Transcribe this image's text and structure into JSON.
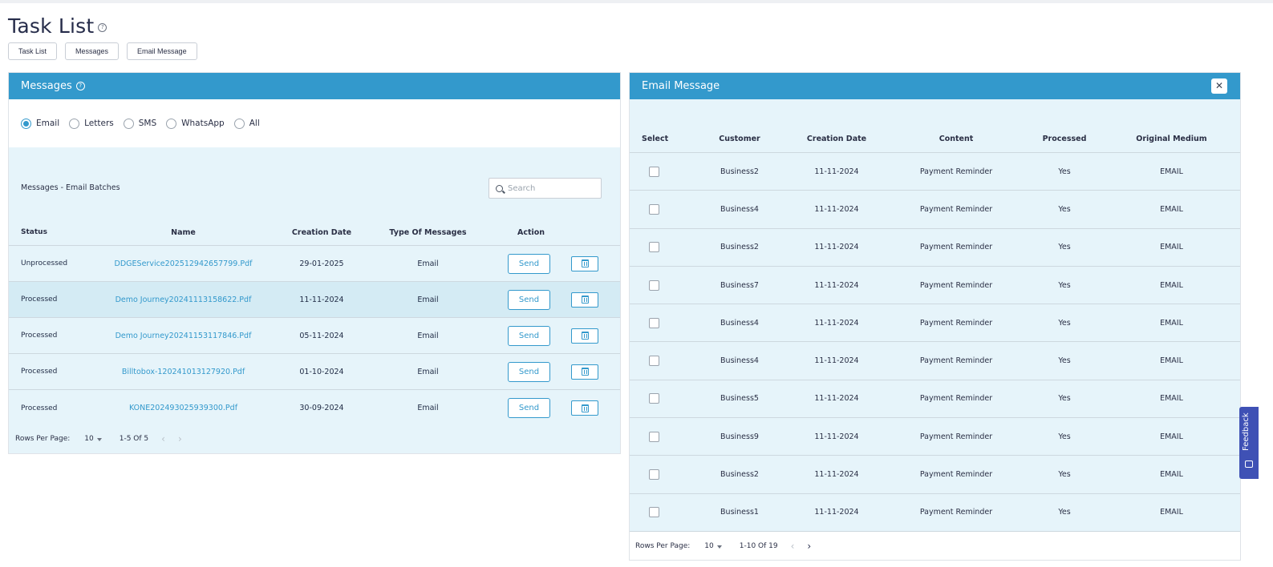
{
  "page": {
    "title": "Task List"
  },
  "tabs": [
    "Task List",
    "Messages",
    "Email Message"
  ],
  "messages_panel": {
    "title": "Messages",
    "radios": [
      {
        "label": "Email",
        "checked": true
      },
      {
        "label": "Letters",
        "checked": false
      },
      {
        "label": "SMS",
        "checked": false
      },
      {
        "label": "WhatsApp",
        "checked": false
      },
      {
        "label": "All",
        "checked": false
      }
    ],
    "batch_title": "Messages - Email Batches",
    "search_placeholder": "Search",
    "columns": [
      "Status",
      "Name",
      "Creation Date",
      "Type Of Messages",
      "Action"
    ],
    "rows": [
      {
        "status": "Unprocessed",
        "name": "DDGEService202512942657799.Pdf",
        "date": "29-01-2025",
        "type": "Email",
        "action": "Send"
      },
      {
        "status": "Processed",
        "name": "Demo Journey20241113158622.Pdf",
        "date": "11-11-2024",
        "type": "Email",
        "action": "Send"
      },
      {
        "status": "Processed",
        "name": "Demo Journey20241153117846.Pdf",
        "date": "05-11-2024",
        "type": "Email",
        "action": "Send"
      },
      {
        "status": "Processed",
        "name": "Billtobox-120241013127920.Pdf",
        "date": "01-10-2024",
        "type": "Email",
        "action": "Send"
      },
      {
        "status": "Processed",
        "name": "KONE202493025939300.Pdf",
        "date": "30-09-2024",
        "type": "Email",
        "action": "Send"
      }
    ],
    "pager": {
      "label": "Rows Per Page:",
      "per_page": "10",
      "range": "1-5 Of 5",
      "prev": "‹",
      "next": "›"
    }
  },
  "email_panel": {
    "title": "Email Message",
    "close": "✕",
    "columns": [
      "Select",
      "Customer",
      "Creation Date",
      "Content",
      "Processed",
      "Original Medium"
    ],
    "rows": [
      {
        "customer": "Business2",
        "date": "11-11-2024",
        "content": "Payment Reminder",
        "processed": "Yes",
        "medium": "EMAIL"
      },
      {
        "customer": "Business4",
        "date": "11-11-2024",
        "content": "Payment Reminder",
        "processed": "Yes",
        "medium": "EMAIL"
      },
      {
        "customer": "Business2",
        "date": "11-11-2024",
        "content": "Payment Reminder",
        "processed": "Yes",
        "medium": "EMAIL"
      },
      {
        "customer": "Business7",
        "date": "11-11-2024",
        "content": "Payment Reminder",
        "processed": "Yes",
        "medium": "EMAIL"
      },
      {
        "customer": "Business4",
        "date": "11-11-2024",
        "content": "Payment Reminder",
        "processed": "Yes",
        "medium": "EMAIL"
      },
      {
        "customer": "Business4",
        "date": "11-11-2024",
        "content": "Payment Reminder",
        "processed": "Yes",
        "medium": "EMAIL"
      },
      {
        "customer": "Business5",
        "date": "11-11-2024",
        "content": "Payment Reminder",
        "processed": "Yes",
        "medium": "EMAIL"
      },
      {
        "customer": "Business9",
        "date": "11-11-2024",
        "content": "Payment Reminder",
        "processed": "Yes",
        "medium": "EMAIL"
      },
      {
        "customer": "Business2",
        "date": "11-11-2024",
        "content": "Payment Reminder",
        "processed": "Yes",
        "medium": "EMAIL"
      },
      {
        "customer": "Business1",
        "date": "11-11-2024",
        "content": "Payment Reminder",
        "processed": "Yes",
        "medium": "EMAIL"
      }
    ],
    "pager": {
      "label": "Rows Per Page:",
      "per_page": "10",
      "range": "1-10 Of 19",
      "prev": "‹",
      "next": "›"
    }
  },
  "feedback": {
    "label": "Feedback"
  },
  "icons": {
    "help": "help-icon",
    "search": "search-icon",
    "trash": "trash-icon",
    "close": "close-icon",
    "caret": "chevron-down-icon"
  },
  "colors": {
    "accent": "#3399cc",
    "feedback": "#3f51b5",
    "panel_bg": "#e6f4fa"
  }
}
